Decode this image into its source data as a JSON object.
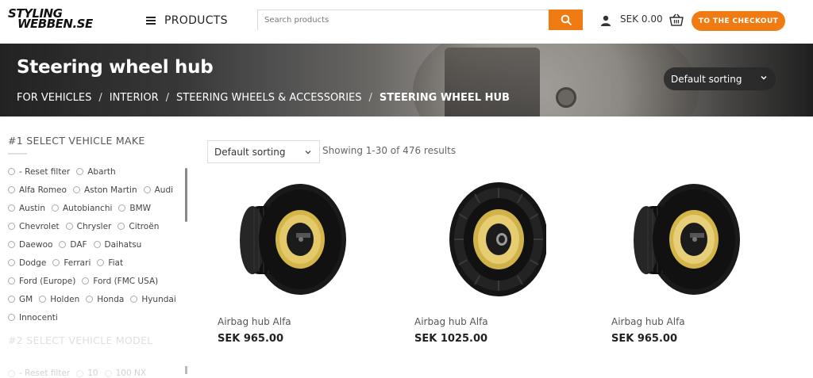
{
  "header": {
    "logo_line1": "STYLING",
    "logo_line2": "WEBBEN.SE",
    "menu_label": "PRODUCTS",
    "search_placeholder": "Search products",
    "cart_total": "SEK 0.00",
    "checkout_label": "TO THE CHECKOUT",
    "accent_color": "#f07b12"
  },
  "banner": {
    "title": "Steering wheel hub",
    "breadcrumbs": [
      "FOR VEHICLES",
      "INTERIOR",
      "STEERING WHEELS & ACCESSORIES",
      "STEERING WHEEL HUB"
    ],
    "sort_label": "Default sorting"
  },
  "sidebar": {
    "section1_title": "#1 SELECT VEHICLE MAKE",
    "makes": [
      "- Reset filter",
      "Abarth",
      "Alfa Romeo",
      "Aston Martin",
      "Audi",
      "Austin",
      "Autobianchi",
      "BMW",
      "Chevrolet",
      "Chrysler",
      "Citroën",
      "Daewoo",
      "DAF",
      "Daihatsu",
      "Dodge",
      "Ferrari",
      "Fiat",
      "Ford (Europe)",
      "Ford (FMC USA)",
      "GM",
      "Holden",
      "Honda",
      "Hyundai",
      "Innocenti"
    ],
    "section2_title": "#2 SELECT VEHICLE MODEL",
    "models": [
      "- Reset filter",
      "10",
      "100 NX"
    ]
  },
  "toolbar": {
    "sort_label": "Default sorting",
    "result_count": "Showing 1-30 of 476 results"
  },
  "products": [
    {
      "name": "Airbag hub Alfa",
      "price": "SEK 965.00",
      "icon": "steering-hub-image"
    },
    {
      "name": "Airbag hub Alfa",
      "price": "SEK 1025.00",
      "icon": "steering-hub-image"
    },
    {
      "name": "Airbag hub Alfa",
      "price": "SEK 965.00",
      "icon": "steering-hub-image"
    }
  ]
}
